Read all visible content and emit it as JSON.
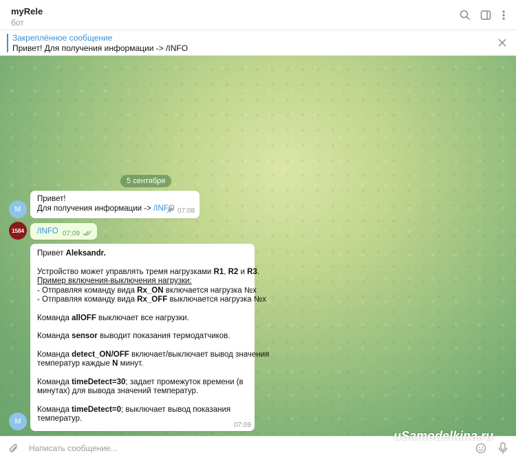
{
  "header": {
    "title": "myRele",
    "subtitle": "бот",
    "icons": [
      "search-icon",
      "sidebar-toggle-icon",
      "more-vertical-icon"
    ]
  },
  "pinned": {
    "title": "Закреплённое сообщение",
    "text": "Привет! Для получения информации -> /INFO"
  },
  "date_separator": "5 сентября",
  "messages": [
    {
      "line1": "Привет!",
      "line2_prefix": "Для получения информации -> ",
      "line2_link": "/INFO",
      "time": "07:08",
      "avatar_letter": "M"
    },
    {
      "text": "/INFO",
      "time": "07:09",
      "avatar_text": "1584"
    },
    {
      "greeting_prefix": "Привет ",
      "greeting_name": "Aleksandr.",
      "p1_prefix": "Устройство может управлять тремя нагрузками ",
      "p1_r1": "R1",
      "p1_sep1": ", ",
      "p1_r2": "R2",
      "p1_sep2": " и ",
      "p1_r3": "R3",
      "p1_end": ".",
      "example_title": "Пример включения-выключения нагрузки:",
      "ex1_prefix": " - Отправляя команду вида ",
      "ex1_cmd": "Rx_ON",
      "ex1_suffix": " включается нагрузка №x",
      "ex2_prefix": " - Отправляя команду вида ",
      "ex2_cmd": "Rx_OFF",
      "ex2_suffix": " выключается нагрузка №x",
      "allOff_prefix": "Команда ",
      "allOff_cmd": "allOFF",
      "allOff_suffix": " выключает все нагрузки.",
      "sensor_prefix": "Команда ",
      "sensor_cmd": "sensor",
      "sensor_suffix": " выводит показания термодатчиков.",
      "detect_prefix": "Команда ",
      "detect_cmd": "detect_ON/OFF",
      "detect_suffix": " включает/выключает вывод значения",
      "detect_line2_prefix": "температур каждые ",
      "detect_line2_n": "N",
      "detect_line2_suffix": " минут.",
      "td30_prefix": "Команда ",
      "td30_cmd": "timeDetect=30",
      "td30_suffix": "; задает промежуток времени (в",
      "td30_line2": "минутах) для вывода значений температур.",
      "td0_prefix": "Команда ",
      "td0_cmd": "timeDetect=0",
      "td0_suffix": "; выключает вывод показания",
      "td0_line2": "температур.",
      "time": "07:09",
      "avatar_letter": "M"
    }
  ],
  "composer": {
    "placeholder": "Написать сообщение..."
  },
  "watermark": "uSamodelkina.ru",
  "colors": {
    "accent": "#3a8fd4",
    "outgoing_bubble": "#effdde",
    "date_pill": "#5b8a56"
  }
}
